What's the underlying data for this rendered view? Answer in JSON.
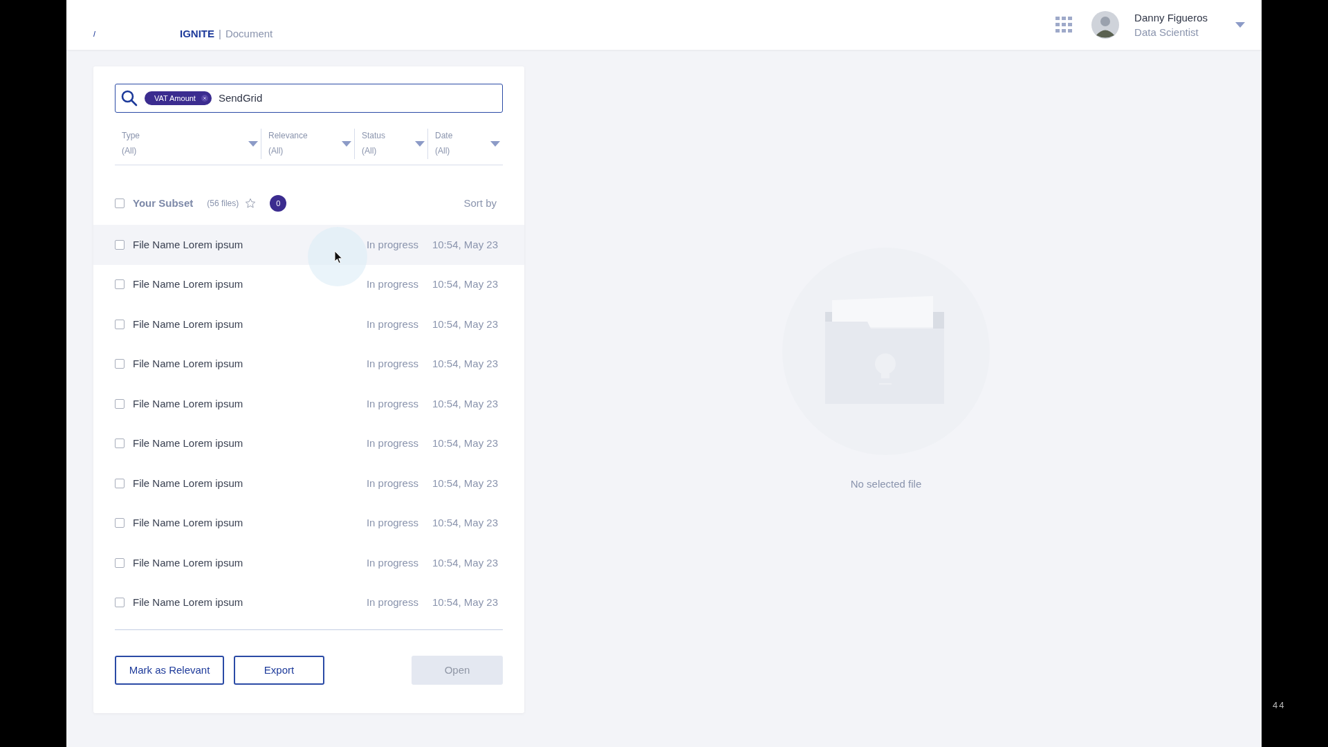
{
  "header": {
    "logo_text": "IGNITE",
    "separator": "|",
    "section": "Document",
    "user": {
      "name": "Danny Figueros",
      "role": "Data Scientist"
    }
  },
  "search": {
    "tags": [
      {
        "label": "VAT Amount"
      }
    ],
    "value": "SendGrid"
  },
  "filters": [
    {
      "label": "Type",
      "value": "(All)"
    },
    {
      "label": "Relevance",
      "value": "(All)"
    },
    {
      "label": "Status",
      "value": "(All)"
    },
    {
      "label": "Date",
      "value": "(All)"
    }
  ],
  "subset": {
    "title": "Your Subset",
    "count": "(56 files)",
    "checked": false,
    "starred": false,
    "badge": "0",
    "sort_label": "Sort by"
  },
  "files": [
    {
      "name": "File Name Lorem ipsum",
      "status": "In progress",
      "time": "10:54, May 23",
      "checked": false,
      "highlighted": true
    },
    {
      "name": "File Name Lorem ipsum",
      "status": "In progress",
      "time": "10:54, May 23",
      "checked": false,
      "highlighted": false
    },
    {
      "name": "File Name Lorem ipsum",
      "status": "In progress",
      "time": "10:54, May 23",
      "checked": false,
      "highlighted": false
    },
    {
      "name": "File Name Lorem ipsum",
      "status": "In progress",
      "time": "10:54, May 23",
      "checked": false,
      "highlighted": false
    },
    {
      "name": "File Name Lorem ipsum",
      "status": "In progress",
      "time": "10:54, May 23",
      "checked": false,
      "highlighted": false
    },
    {
      "name": "File Name Lorem ipsum",
      "status": "In progress",
      "time": "10:54, May 23",
      "checked": false,
      "highlighted": false
    },
    {
      "name": "File Name Lorem ipsum",
      "status": "In progress",
      "time": "10:54, May 23",
      "checked": false,
      "highlighted": false
    },
    {
      "name": "File Name Lorem ipsum",
      "status": "In progress",
      "time": "10:54, May 23",
      "checked": false,
      "highlighted": false
    },
    {
      "name": "File Name Lorem ipsum",
      "status": "In progress",
      "time": "10:54, May 23",
      "checked": false,
      "highlighted": false
    },
    {
      "name": "File Name Lorem ipsum",
      "status": "In progress",
      "time": "10:54, May 23",
      "checked": false,
      "highlighted": false
    }
  ],
  "buttons": [
    {
      "label": "Mark as Relevant",
      "disabled": false
    },
    {
      "label": "Export",
      "disabled": false
    },
    {
      "label": "Open",
      "disabled": true
    }
  ],
  "preview": {
    "empty_text": "No selected file"
  },
  "page_number": "44"
}
